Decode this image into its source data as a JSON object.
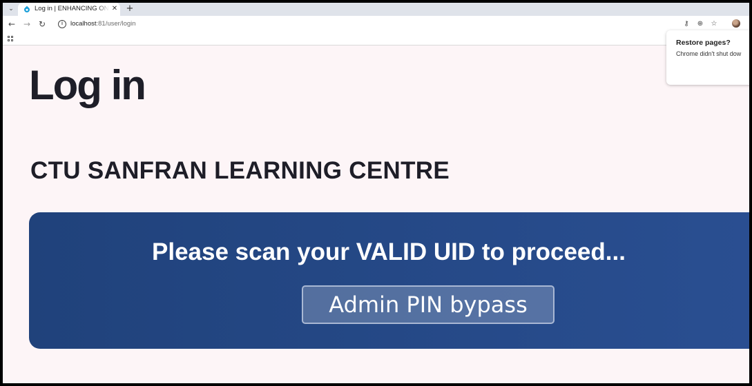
{
  "browser": {
    "tab": {
      "title": "Log in | ENHANCING ON",
      "close": "✕"
    },
    "tab_list_glyph": "⌄",
    "new_tab_glyph": "+",
    "nav": {
      "back": "←",
      "forward": "→",
      "reload": "↻"
    },
    "url": {
      "host": "localhost",
      "path": ":81/user/login"
    },
    "toolbar_icons": {
      "password": "⚷",
      "zoom": "⊕",
      "bookmark": "☆"
    },
    "restore_popup": {
      "title": "Restore pages?",
      "body": "Chrome didn't shut dow"
    }
  },
  "page": {
    "title": "Log in",
    "org_name": "CTU SANFRAN LEARNING CENTRE",
    "scan_message": "Please scan your VALID UID to proceed...",
    "pin_button_label": "Admin PIN bypass"
  },
  "colors": {
    "card_start": "#20427b",
    "card_end": "#2a4f92",
    "page_background": "#fdf5f7",
    "heading_text": "#1e1e28"
  }
}
